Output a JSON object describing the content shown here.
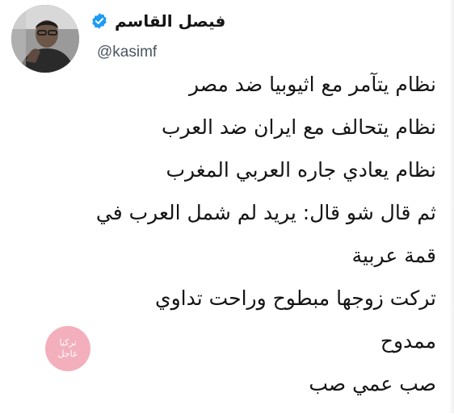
{
  "author": {
    "display_name": "فيصل القاسم",
    "handle": "@kasimf",
    "verified": true,
    "verified_badge_color": "#1d9bf0"
  },
  "tweet": {
    "lines": [
      "نظام  يتآمر مع اثيوبيا ضد مصر",
      "نظام يتحالف مع ايران ضد العرب",
      "نظام يعادي جاره العربي المغرب",
      "ثم قال شو قال: يريد لم شمل العرب في",
      "قمة عربية",
      "تركت زوجها مبطوح وراحت تداوي",
      "ممدوح",
      "صب عمي صب"
    ]
  },
  "watermark": {
    "line1": "تركيا",
    "line2": "عاجل",
    "color": "#f2a7b5"
  }
}
